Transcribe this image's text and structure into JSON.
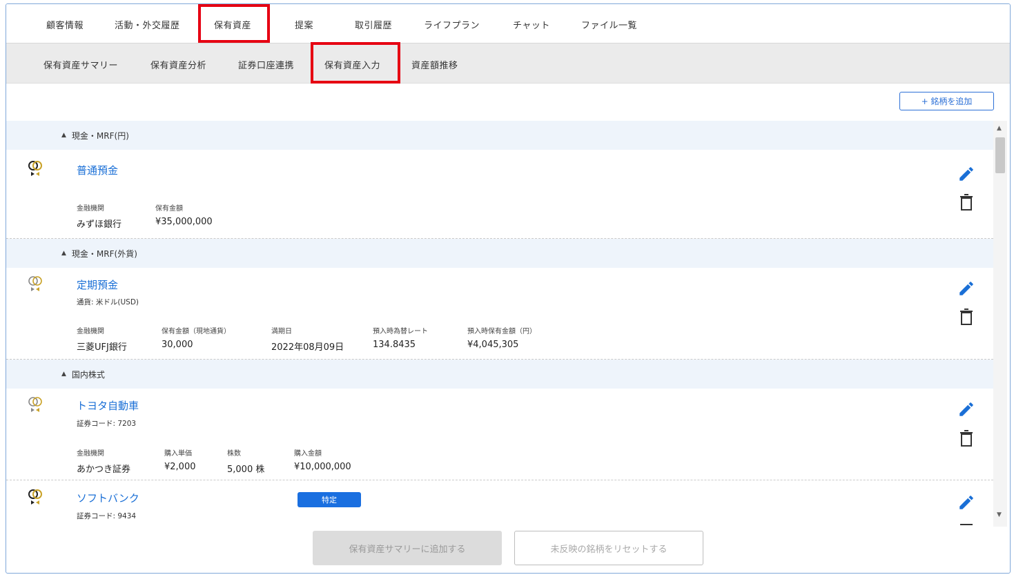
{
  "top_tabs": [
    "顧客情報",
    "活動・外交履歴",
    "保有資産",
    "提案",
    "取引履歴",
    "ライフプラン",
    "チャット",
    "ファイル一覧"
  ],
  "sub_tabs": [
    "保有資産サマリー",
    "保有資産分析",
    "証券口座連携",
    "保有資産入力",
    "資産額推移"
  ],
  "active_top_tab": "保有資産",
  "active_sub_tab": "保有資産入力",
  "highlight_color": "#e60012",
  "accent_color": "#1a6fd6",
  "add_button_label": "+ 銘柄を追加",
  "sections": {
    "cash_jpy": {
      "title": "現金・MRF(円)",
      "item": {
        "name": "普通預金",
        "fields": [
          {
            "label": "金融機関",
            "value": "みずほ銀行"
          },
          {
            "label": "保有金額",
            "value": "¥35,000,000"
          }
        ]
      }
    },
    "cash_fx": {
      "title": "現金・MRF(外貨)",
      "item": {
        "name": "定期預金",
        "sub": "通貨: 米ドル(USD)",
        "fields": [
          {
            "label": "金融機関",
            "value": "三菱UFJ銀行"
          },
          {
            "label": "保有金額（現地通貨）",
            "value": "30,000"
          },
          {
            "label": "満期日",
            "value": "2022年08月09日"
          },
          {
            "label": "預入時為替レート",
            "value": "134.8435"
          },
          {
            "label": "預入時保有金額（円）",
            "value": "¥4,045,305"
          }
        ]
      }
    },
    "domestic_stock": {
      "title": "国内株式",
      "items": [
        {
          "name": "トヨタ自動車",
          "sub": "証券コード: 7203",
          "fields": [
            {
              "label": "金融機関",
              "value": "あかつき証券"
            },
            {
              "label": "購入単価",
              "value": "¥2,000"
            },
            {
              "label": "株数",
              "value": "5,000 株"
            },
            {
              "label": "購入金額",
              "value": "¥10,000,000"
            }
          ]
        },
        {
          "name": "ソフトバンク",
          "sub": "証券コード: 9434",
          "badge": "特定"
        }
      ]
    }
  },
  "bottom_buttons": {
    "add_to_summary": "保有資産サマリーに追加する",
    "reset": "未反映の銘柄をリセットする"
  },
  "icons": {
    "asset": "rings-icon",
    "edit": "pencil-icon",
    "delete": "trash-icon",
    "section_toggle": "triangle-up-icon"
  }
}
